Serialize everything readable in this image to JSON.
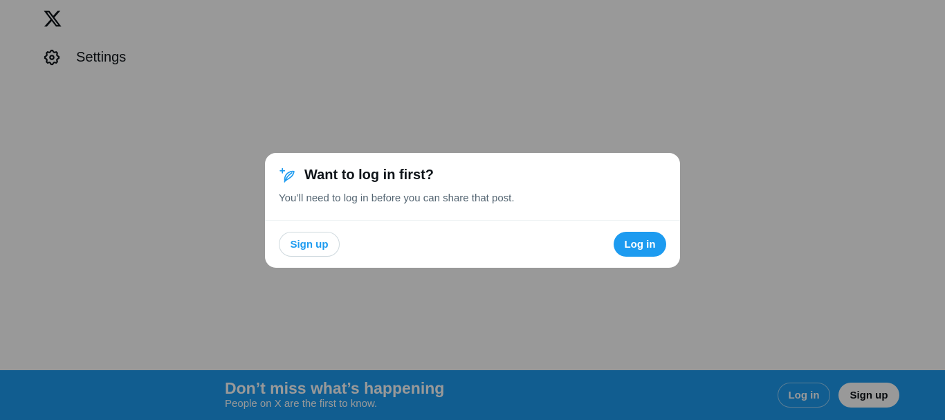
{
  "nav": {
    "logo_icon": "x-logo-icon",
    "items": [
      {
        "label": "Settings",
        "icon": "gear-icon"
      }
    ]
  },
  "banner": {
    "title": "Don’t miss what’s happening",
    "subtitle": "People on X are the first to know.",
    "login_label": "Log in",
    "signup_label": "Sign up",
    "background": "#1d9bf0"
  },
  "modal": {
    "icon": "feather-sparkle-icon",
    "title": "Want to log in first?",
    "body": "You’ll need to log in before you can share that post.",
    "signup_label": "Sign up",
    "login_label": "Log in"
  },
  "colors": {
    "accent": "#1d9bf0",
    "text": "#0f1419",
    "secondary_text": "#536471",
    "overlay": "rgba(0,0,0,0.4)"
  }
}
